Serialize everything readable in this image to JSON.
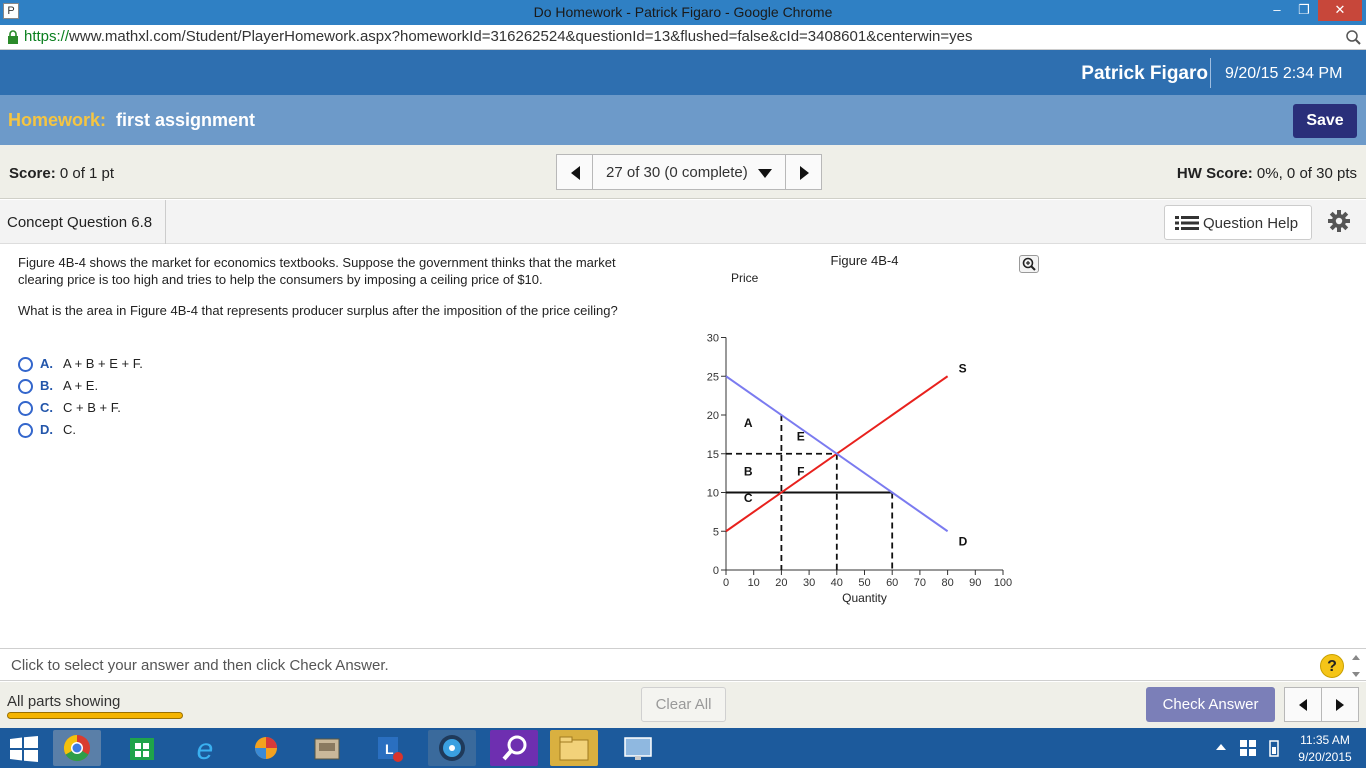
{
  "window": {
    "title": "Do Homework - Patrick Figaro - Google Chrome",
    "app_icon_letter": "P",
    "minimize": "–",
    "restore": "❐",
    "close": "✕"
  },
  "address": {
    "scheme": "https://",
    "rest": "www.mathxl.com/Student/PlayerHomework.aspx?homeworkId=316262524&questionId=13&flushed=false&cId=3408601&centerwin=yes"
  },
  "header": {
    "user": "Patrick Figaro",
    "datetime": "9/20/15 2:34 PM"
  },
  "homework": {
    "label": "Homework:",
    "name": "first assignment",
    "save_label": "Save"
  },
  "score": {
    "label": "Score:",
    "value": "0 of 1 pt",
    "nav_position": "27 of 30 (0 complete)",
    "hw_label": "HW Score:",
    "hw_value": "0%, 0 of 30 pts"
  },
  "concept": {
    "title": "Concept Question 6.8",
    "help_label": "Question Help"
  },
  "question": {
    "p1": "Figure 4B-4 shows the market for economics textbooks. Suppose the government thinks that the market clearing price is too high and tries to help the consumers by imposing a ceiling price of $10.",
    "p2": "What is the area in Figure 4B-4 that represents producer surplus after the imposition of the price ceiling?",
    "options": [
      {
        "letter": "A.",
        "text": "A + B + E + F."
      },
      {
        "letter": "B.",
        "text": "A + E."
      },
      {
        "letter": "C.",
        "text": "C + B + F."
      },
      {
        "letter": "D.",
        "text": "C."
      }
    ]
  },
  "chart_data": {
    "type": "line",
    "title": "Figure 4B-4",
    "xlabel": "Quantity",
    "ylabel": "Price",
    "xlim": [
      0,
      100
    ],
    "ylim": [
      0,
      30
    ],
    "xticks": [
      0,
      10,
      20,
      30,
      40,
      50,
      60,
      70,
      80,
      90,
      100
    ],
    "yticks": [
      0,
      5,
      10,
      15,
      20,
      25,
      30
    ],
    "series": [
      {
        "name": "S",
        "color": "#e8211d",
        "points": [
          [
            0,
            5
          ],
          [
            80,
            25
          ]
        ]
      },
      {
        "name": "D",
        "color": "#7b7bf0",
        "points": [
          [
            0,
            25
          ],
          [
            80,
            5
          ]
        ]
      }
    ],
    "ceiling_line": {
      "y": 10,
      "x_range": [
        0,
        60
      ]
    },
    "equilibrium_dashed": {
      "y": 15,
      "x": 40
    },
    "vertical_dashed": [
      20,
      40,
      60
    ],
    "areas": [
      {
        "label": "A",
        "x": 8,
        "y": 19
      },
      {
        "label": "E",
        "x": 27,
        "y": 17.2
      },
      {
        "label": "B",
        "x": 8,
        "y": 12.7
      },
      {
        "label": "F",
        "x": 27,
        "y": 12.7
      },
      {
        "label": "C",
        "x": 8,
        "y": 9.3
      }
    ]
  },
  "hint": "Click to select your answer and then click Check Answer.",
  "hint_help": "?",
  "actions": {
    "all_parts": "All parts showing",
    "clear_all": "Clear All",
    "check_answer": "Check Answer"
  },
  "taskbar": {
    "time": "11:35 AM",
    "date": "9/20/2015"
  }
}
